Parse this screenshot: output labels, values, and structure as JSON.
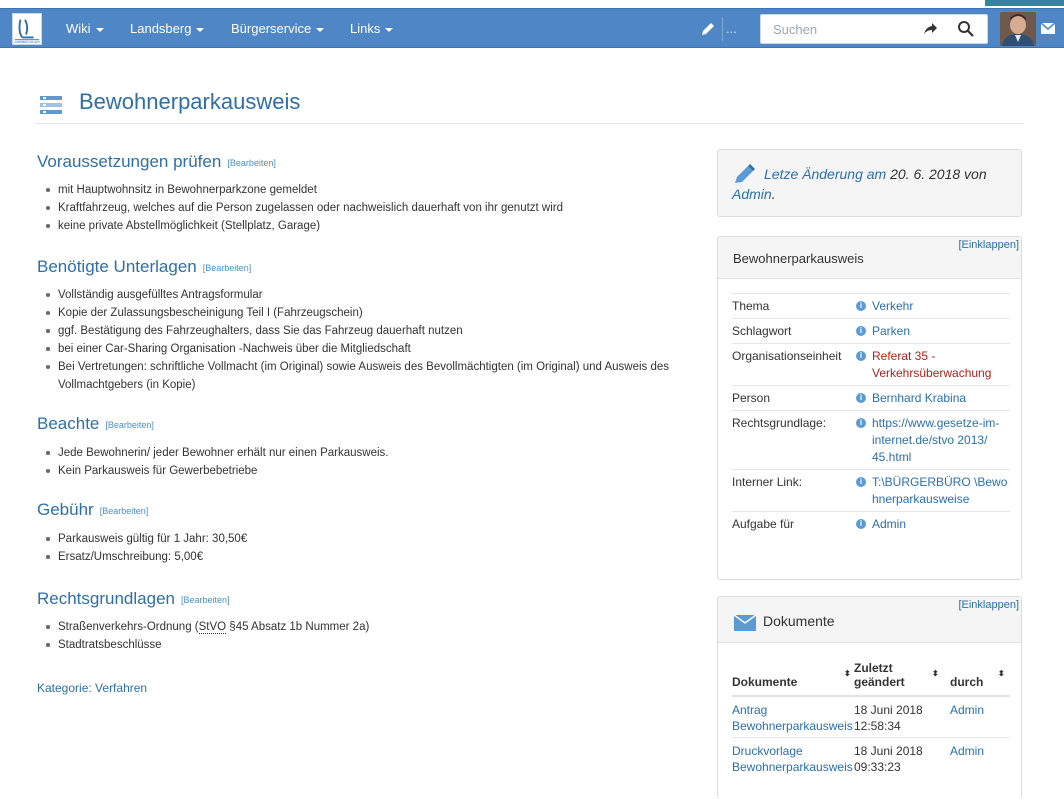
{
  "navbar": {
    "logo_text": "LANDSBERG AM LECH",
    "items": [
      {
        "label": "Wiki"
      },
      {
        "label": "Landsberg"
      },
      {
        "label": "Bürgerservice"
      },
      {
        "label": "Links"
      }
    ],
    "more_label": "...",
    "search_placeholder": "Suchen",
    "accent_color": "#4f86c6"
  },
  "page": {
    "title": "Bewohnerparkausweis"
  },
  "sections": [
    {
      "title": "Voraussetzungen prüfen",
      "edit": "[Bearbeiten]",
      "items": [
        "mit Hauptwohnsitz in Bewohnerparkzone gemeldet",
        "Kraftfahrzeug, welches auf die Person zugelassen oder nachweislich dauerhaft von ihr genutzt wird",
        "keine private Abstellmöglichkeit (Stellplatz, Garage)"
      ]
    },
    {
      "title": "Benötigte Unterlagen",
      "edit": "[Bearbeiten]",
      "items": [
        "Vollständig ausgefülltes Antragsformular",
        "Kopie der Zulassungsbescheinigung Teil I (Fahrzeugschein)",
        "ggf. Bestätigung des Fahrzeughalters, dass Sie das Fahrzeug dauerhaft nutzen",
        "bei einer Car-Sharing Organisation -Nachweis über die Mitgliedschaft",
        "Bei Vertretungen: schriftliche Vollmacht (im Original) sowie Ausweis des Bevollmächtigten (im Original) und Ausweis des Vollmachtgebers (in Kopie)"
      ]
    },
    {
      "title": "Beachte",
      "edit": "[Bearbeiten]",
      "items": [
        "Jede Bewohnerin/ jeder Bewohner erhält nur einen Parkausweis.",
        "Kein Parkausweis für Gewerbebetriebe"
      ]
    },
    {
      "title": "Gebühr",
      "edit": "[Bearbeiten]",
      "items": [
        "Parkausweis gültig für 1 Jahr: 30,50€",
        "Ersatz/Umschreibung: 5,00€"
      ]
    },
    {
      "title": "Rechtsgrundlagen",
      "edit": "[Bearbeiten]",
      "items_rich": {
        "item1_pre": "Straßenverkehrs-Ordnung (",
        "item1_link": "StVO",
        "item1_post": " §45 Absatz 1b Nummer 2a)",
        "item2": "Stadtratsbeschlüsse"
      }
    }
  ],
  "category": {
    "label": "Kategorie",
    "value": "Verfahren"
  },
  "last_change": {
    "prefix": "Letze Änderung am",
    "date": " 20. 6. 2018 von ",
    "author": "Admin",
    "suffix": "."
  },
  "infobox": {
    "title": "Bewohnerparkausweis",
    "collapse": "[Einklappen]",
    "rows": [
      {
        "key": "Thema",
        "value": "Verkehr"
      },
      {
        "key": "Schlagwort",
        "value": "Parken"
      },
      {
        "key": "Organisationseinheit",
        "value": "Referat 35 - Verkehrsüberwachung"
      },
      {
        "key": "Person",
        "value": "Bernhard Krabina"
      },
      {
        "key": "Rechtsgrundlage:",
        "value": "https://www.gesetze-im-internet.de/stvo 2013/ 45.html"
      },
      {
        "key": "Interner Link:",
        "value": "T:\\BÜRGERBÜRO \\Bewohnerparkausweise"
      },
      {
        "key": "Aufgabe für",
        "value": "Admin"
      }
    ]
  },
  "documents": {
    "title": "Dokumente",
    "collapse": "[Einklappen]",
    "headers": [
      "Dokumente",
      "Zuletzt geändert",
      "durch"
    ],
    "rows": [
      {
        "name": "Antrag Bewohnerparkausweis",
        "date": "18 Juni 2018 12:58:34",
        "by": "Admin"
      },
      {
        "name": "Druckvorlage Bewohnerparkausweis",
        "date": "18 Juni 2018 09:33:23",
        "by": "Admin"
      }
    ]
  }
}
